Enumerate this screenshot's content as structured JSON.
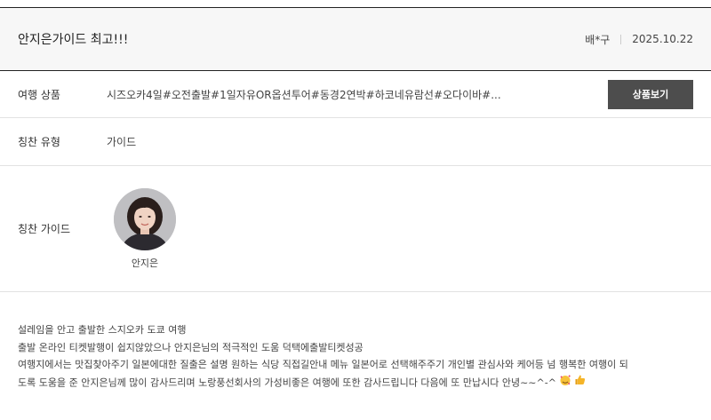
{
  "review": {
    "title": "안지은가이드 최고!!!",
    "author": "배*구",
    "date": "2025.10.22"
  },
  "product": {
    "label": "여행 상품",
    "value": "시즈오카4일#오전출발#1일자유OR옵션투어#동경2연박#하코네유람선#오다이바#...",
    "button_label": "상품보기"
  },
  "praise_type": {
    "label": "칭찬 유형",
    "value": "가이드"
  },
  "praise_guide": {
    "label": "칭찬 가이드",
    "name": "안지은"
  },
  "body": {
    "line1": "설레임을 안고 출발한 스지오카 도쿄 여행",
    "line2": "출발 온라인 티켓발행이 쉽지않았으나 안지은님의 적극적인 도움 덕택에출발티켓성공",
    "line3": "여행지에서는 맛집찾아주기 일본에대한 질출은 설명 원하는 식당 직접길안내 메뉴 일본어로 선택해주주기 개인별 관심사와 케어등 넘 행복한 여행이 되",
    "line4": "도록 도움을 준 안지은님께 많이 감사드리며 노랑풍선회사의 가성비좋은 여행에 또한 감사드립니다 다음에 또 만납시다 안녕~~^-^"
  },
  "icons": {
    "emoji1": "smiling-face-with-hearts-icon",
    "emoji2": "thumbs-up-icon"
  }
}
